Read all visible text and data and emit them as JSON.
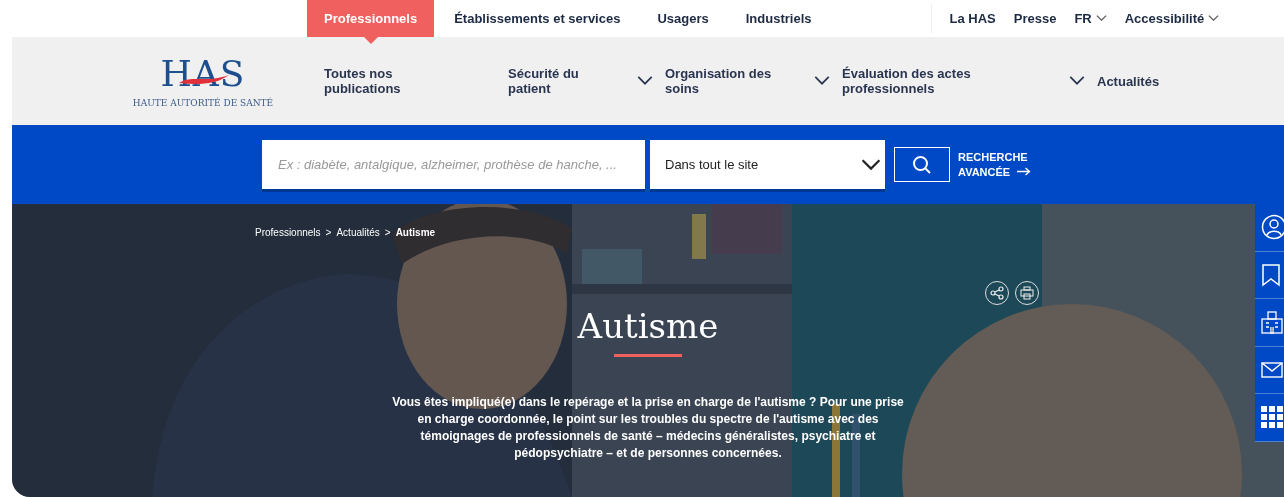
{
  "audience_tabs": [
    {
      "label": "Professionnels",
      "selected": true
    },
    {
      "label": "Établissements et services",
      "selected": false
    },
    {
      "label": "Usagers",
      "selected": false
    },
    {
      "label": "Industriels",
      "selected": false
    }
  ],
  "utility_links": [
    {
      "label": "La HAS",
      "dropdown": false
    },
    {
      "label": "Presse",
      "dropdown": false
    },
    {
      "label": "FR",
      "dropdown": true
    },
    {
      "label": "Accessibilité",
      "dropdown": true
    }
  ],
  "logo": {
    "mark": "HAS",
    "tagline": "HAUTE AUTORITÉ DE SANTÉ"
  },
  "main_nav": [
    {
      "label": "Toutes nos publications",
      "dropdown": false
    },
    {
      "label": "Sécurité du patient",
      "dropdown": true
    },
    {
      "label": "Organisation des soins",
      "dropdown": true
    },
    {
      "label": "Évaluation des actes professionnels",
      "dropdown": true
    },
    {
      "label": "Actualités",
      "dropdown": false
    }
  ],
  "search": {
    "placeholder": "Ex : diabète, antalgique, alzheimer, prothèse de hanche, ...",
    "scope": "Dans tout le site",
    "advanced_link": "RECHERCHE AVANCÉE"
  },
  "breadcrumb": [
    {
      "label": "Professionnels",
      "current": false
    },
    {
      "label": "Actualités",
      "current": false
    },
    {
      "label": "Autisme",
      "current": true
    }
  ],
  "breadcrumb_separator": ">",
  "hero": {
    "title": "Autisme",
    "intro": "Vous êtes impliqué(e) dans le repérage et la prise en charge de l'autisme ? Pour une prise en charge coordonnée, le point sur les troubles du spectre de l'autisme avec des témoignages de professionnels de santé – médecins généralistes, psychiatre et pédopsychiatre – et de personnes concernées."
  }
}
